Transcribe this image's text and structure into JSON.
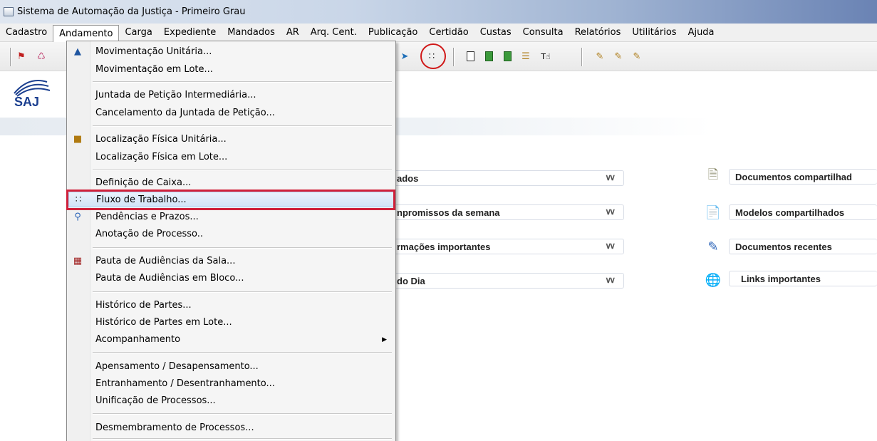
{
  "window": {
    "title": "Sistema de Automação da Justiça - Primeiro Grau"
  },
  "menubar": [
    {
      "label": "Cadastro"
    },
    {
      "label": "Andamento"
    },
    {
      "label": "Carga"
    },
    {
      "label": "Expediente"
    },
    {
      "label": "Mandados"
    },
    {
      "label": "AR"
    },
    {
      "label": "Arq. Cent."
    },
    {
      "label": "Publicação"
    },
    {
      "label": "Certidão"
    },
    {
      "label": "Custas"
    },
    {
      "label": "Consulta"
    },
    {
      "label": "Relatórios"
    },
    {
      "label": "Utilitários"
    },
    {
      "label": "Ajuda"
    }
  ],
  "logo": {
    "text": "SAJ"
  },
  "dropdown": {
    "items": [
      {
        "label": "Movimentação Unitária...",
        "icon": "process-move-icon"
      },
      {
        "label": "Movimentação em Lote..."
      },
      {
        "label": "Juntada de Petição Intermediária..."
      },
      {
        "label": "Cancelamento da Juntada de Petição..."
      },
      {
        "label": "Localização Física Unitária...",
        "icon": "location-folder-icon"
      },
      {
        "label": "Localização Física em Lote..."
      },
      {
        "label": "Definição de Caixa..."
      },
      {
        "label": "Fluxo de Trabalho...",
        "icon": "workflow-icon",
        "selected": true
      },
      {
        "label": "Pendências e Prazos...",
        "icon": "search-doc-icon"
      },
      {
        "label": "Anotação de Processo.."
      },
      {
        "label": "Pauta de Audiências da Sala...",
        "icon": "calendar-grid-icon"
      },
      {
        "label": "Pauta de Audiências em Bloco..."
      },
      {
        "label": "Histórico de Partes..."
      },
      {
        "label": "Histórico de Partes em Lote..."
      },
      {
        "label": "Acompanhamento",
        "submenu": true
      },
      {
        "label": "Apensamento / Desapensamento..."
      },
      {
        "label": "Entranhamento / Desentranhamento..."
      },
      {
        "label": "Unificação de Processos..."
      },
      {
        "label": "Desmembramento de Processos..."
      }
    ]
  },
  "panels": [
    {
      "label": "ados"
    },
    {
      "label": "npromissos da semana"
    },
    {
      "label": "rmações importantes"
    },
    {
      "label": "do Dia"
    }
  ],
  "links": [
    {
      "label": "Documentos compartilhad",
      "icon": "shared-documents-icon"
    },
    {
      "label": "Modelos compartilhados",
      "icon": "shared-models-icon"
    },
    {
      "label": "Documentos recentes",
      "icon": "recent-documents-icon"
    },
    {
      "label": "Links importantes",
      "icon": "globe-links-icon"
    }
  ],
  "toolbar": {
    "highlighted_icon": "workflow-icon"
  },
  "colors": {
    "highlight_red": "#d01818",
    "selection_blue": "#d2e3f7",
    "logo_blue": "#1b3f8f"
  }
}
